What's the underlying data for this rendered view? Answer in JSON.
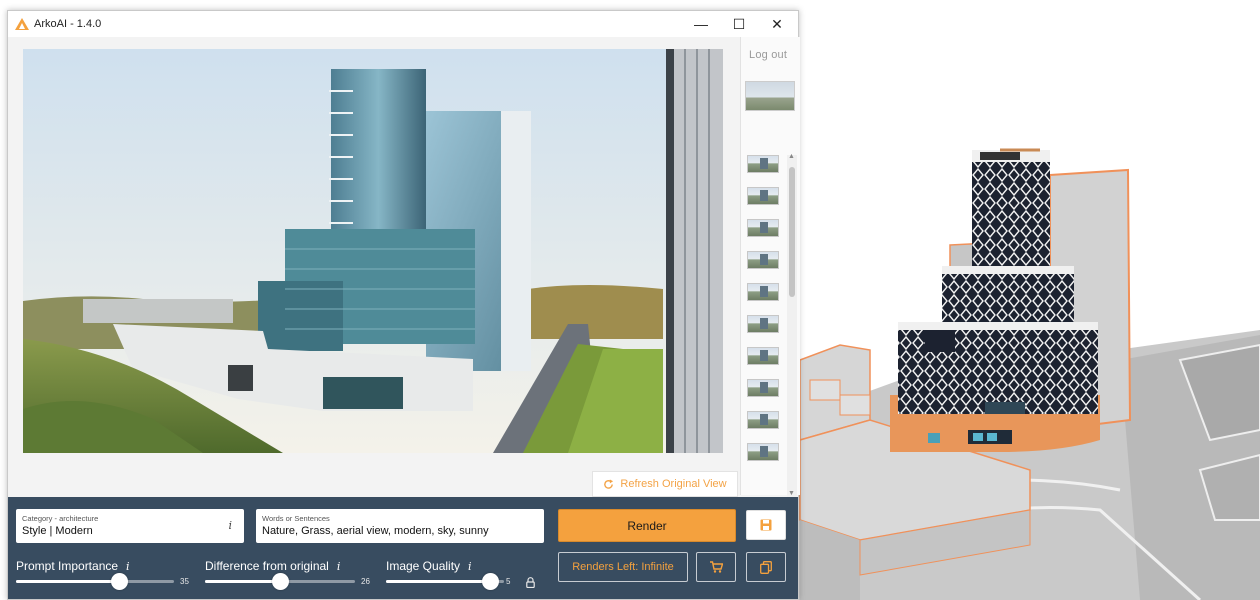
{
  "window": {
    "title": "ArkoAI - 1.4.0",
    "minimize_glyph": "—",
    "maximize_glyph": "☐",
    "close_glyph": "✕"
  },
  "side_panel": {
    "logout_label": "Log out",
    "thumbnail_count": 10
  },
  "refresh_button": {
    "label": "Refresh Original View",
    "icon": "refresh-icon"
  },
  "category_field": {
    "caption": "Category - architecture",
    "value": "Style | Modern",
    "info_glyph": "i"
  },
  "words_field": {
    "caption": "Words or Sentences",
    "value": "Nature, Grass, aerial view, modern, sky, sunny"
  },
  "render_button": {
    "label": "Render"
  },
  "renders_left_button": {
    "label": "Renders Left: Infinite"
  },
  "sliders": [
    {
      "label": "Prompt Importance",
      "value": "35",
      "fraction": 0.65
    },
    {
      "label": "Difference from original",
      "value": "26",
      "fraction": 0.5
    },
    {
      "label": "Image Quality",
      "value": "5",
      "fraction": 0.88
    }
  ],
  "colors": {
    "accent": "#f4a13e",
    "control_bar": "#384c60",
    "window_bg": "#f3f3f3"
  },
  "icons": [
    "arko-logo-icon",
    "save-icon",
    "cart-icon",
    "copy-icon",
    "lock-icon",
    "info-icon",
    "refresh-icon"
  ]
}
